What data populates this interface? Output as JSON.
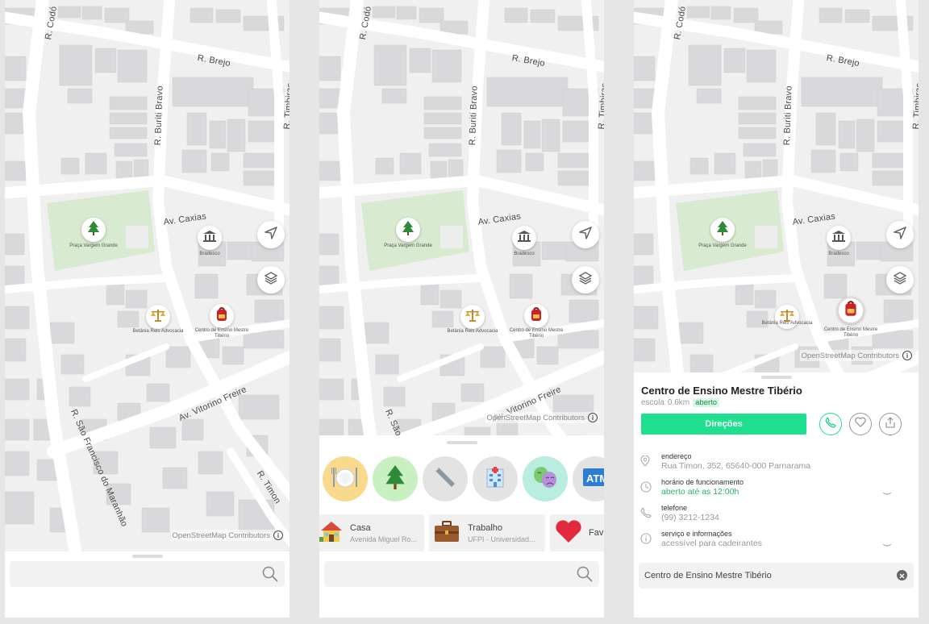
{
  "map": {
    "streets": {
      "codo": "R. Codó",
      "brejo": "R. Brejo",
      "buriti": "R. Buriti Bravo",
      "timbiras": "R. Timbiras",
      "caxias": "Av. Caxias",
      "vitorino": "Av. Vitorino Freire",
      "sao_francisco": "R. São Francisco do Maranhão",
      "timon": "R. Timon"
    },
    "pois": {
      "park": "Praça Vargem Grande",
      "bank": "Bradesco",
      "law": "Betânia Reis Advocacia",
      "school": "Centro de Ensino Mestre Tibério"
    },
    "credit": "OpenStreetMap Contributors",
    "icons": [
      "tree-icon",
      "bank-icon",
      "scales-icon",
      "school-backpack-icon",
      "navigation-arrow-icon",
      "layers-icon",
      "info-icon"
    ]
  },
  "search": {
    "placeholder": "",
    "selected_value": "Centro de Ensino Mestre Tibério"
  },
  "categories": [
    {
      "name": "restaurant",
      "icon": "plate-cutlery-icon",
      "color": "#f9d98c"
    },
    {
      "name": "park",
      "icon": "tree-icon",
      "color": "#c8f0c1"
    },
    {
      "name": "services",
      "icon": "wrench-icon",
      "color": "#e3e3e3"
    },
    {
      "name": "hospital",
      "icon": "hospital-icon",
      "color": "#e3e3e3"
    },
    {
      "name": "theater",
      "icon": "theater-masks-icon",
      "color": "#b9ede0"
    },
    {
      "name": "atm",
      "icon": "atm-icon",
      "color": "#e3e3e3"
    }
  ],
  "favorites": [
    {
      "title": "Casa",
      "subtitle": "Avenida Miguel Ro...",
      "icon": "house-icon"
    },
    {
      "title": "Trabalho",
      "subtitle": "UFPI - Universidad...",
      "icon": "briefcase-icon"
    },
    {
      "title": "Fav",
      "subtitle": "",
      "icon": "heart-icon"
    }
  ],
  "place": {
    "name": "Centro de Ensino Mestre Tibério",
    "category": "escola",
    "distance": "0.6km",
    "status": "aberto",
    "directions_label": "Direções",
    "details": [
      {
        "label": "endereço",
        "value": "Rua Timon, 352, 65640-000 Parnarama",
        "icon": "pin-icon"
      },
      {
        "label": "horário de funcionamento",
        "value": "aberto até as 12:00h",
        "icon": "clock-icon"
      },
      {
        "label": "telefone",
        "value": "(99) 3212-1234",
        "icon": "phone-icon"
      },
      {
        "label": "serviço e informações",
        "value": "acessível para cadeirantes",
        "icon": "info-icon"
      }
    ]
  },
  "colors": {
    "accent": "#1ee08f",
    "open_text": "#2ab56a",
    "open_badge_bg": "#d6f7e4",
    "park": "#d8ead0",
    "building": "#d9d9db",
    "road": "#ffffff"
  }
}
